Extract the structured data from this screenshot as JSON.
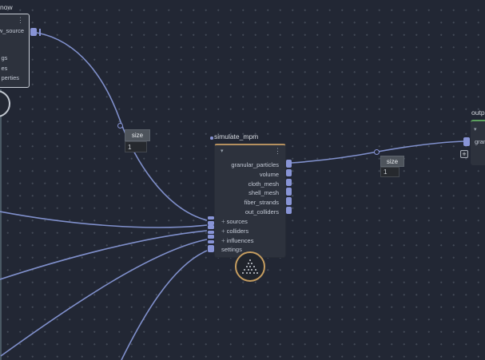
{
  "colors": {
    "background": "#222734",
    "grid_dot": "#434a57",
    "wire": "#8090cc",
    "port": "#8894d6",
    "node_background": "#2d323d",
    "simulate_accent_bar": "#b5905f",
    "output_accent_bar": "#5ca05e",
    "selected_node_border": "#c9ced6",
    "badge_ring": "#c59d60"
  },
  "icons": {
    "menu": "⋮",
    "collapse": "▾",
    "plus": "+"
  },
  "nodes": {
    "clipped_left": {
      "title": "now",
      "output_label": "w_source",
      "input_labels": [
        "gs",
        "es",
        "perties"
      ]
    },
    "simulate_mpm": {
      "title": "simulate_mpm",
      "outputs": [
        "granular_particles",
        "volume",
        "cloth_mesh",
        "shell_mesh",
        "fiber_strands",
        "out_colliders"
      ],
      "inputs": [
        "sources",
        "colliders",
        "influences",
        "settings"
      ]
    },
    "output_right": {
      "title": "outp",
      "input_label": "gran",
      "add_button": "+"
    },
    "size_pin_left": {
      "label": "size",
      "value": "1"
    },
    "size_pin_right": {
      "label": "size",
      "value": "1"
    }
  }
}
